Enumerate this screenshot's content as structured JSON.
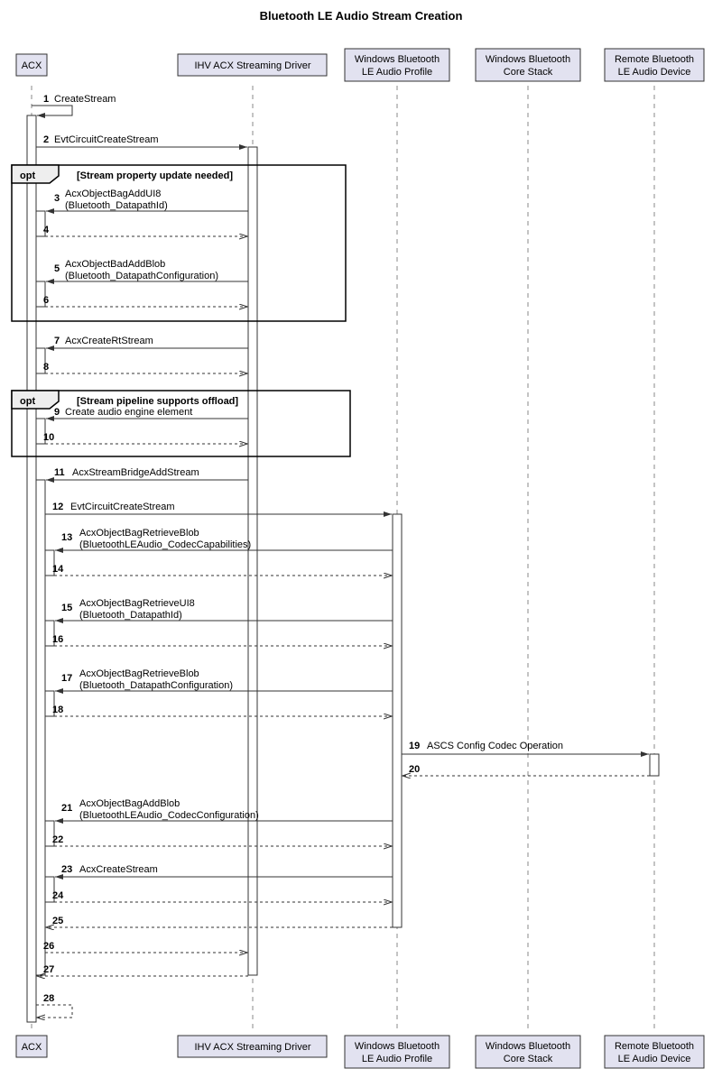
{
  "title": "Bluetooth LE Audio Stream Creation",
  "participants": [
    {
      "name": "ACX",
      "lines": [
        "ACX"
      ]
    },
    {
      "name": "IHV",
      "lines": [
        "IHV ACX Streaming Driver"
      ]
    },
    {
      "name": "WBAP",
      "lines": [
        "Windows Bluetooth",
        "LE Audio Profile"
      ]
    },
    {
      "name": "WBCS",
      "lines": [
        "Windows Bluetooth",
        "Core Stack"
      ]
    },
    {
      "name": "RBLD",
      "lines": [
        "Remote Bluetooth",
        "LE Audio Device"
      ]
    }
  ],
  "opt1_label": "opt",
  "opt1_cond": "[Stream property update needed]",
  "opt2_label": "opt",
  "opt2_cond": "[Stream pipeline supports offload]",
  "messages": {
    "m1": "CreateStream",
    "m2": "EvtCircuitCreateStream",
    "m3a": "AcxObjectBagAddUI8",
    "m3b": "(Bluetooth_DatapathId)",
    "m5a": "AcxObjectBadAddBlob",
    "m5b": "(Bluetooth_DatapathConfiguration)",
    "m7": "AcxCreateRtStream",
    "m9": "Create audio engine element",
    "m11": "AcxStreamBridgeAddStream",
    "m12": "EvtCircuitCreateStream",
    "m13a": "AcxObjectBagRetrieveBlob",
    "m13b": "(BluetoothLEAudio_CodecCapabilities)",
    "m15a": "AcxObjectBagRetrieveUI8",
    "m15b": "(Bluetooth_DatapathId)",
    "m17a": "AcxObjectBagRetrieveBlob",
    "m17b": "(Bluetooth_DatapathConfiguration)",
    "m19": "ASCS Config Codec Operation",
    "m21a": "AcxObjectBagAddBlob",
    "m21b": "(BluetoothLEAudio_CodecConfiguration)",
    "m23": "AcxCreateStream"
  },
  "chart_data": {
    "type": "sequence-diagram",
    "title": "Bluetooth LE Audio Stream Creation",
    "participants": [
      "ACX",
      "IHV ACX Streaming Driver",
      "Windows Bluetooth LE Audio Profile",
      "Windows Bluetooth Core Stack",
      "Remote Bluetooth LE Audio Device"
    ],
    "messages": [
      {
        "n": 1,
        "from": "ACX",
        "to": "ACX",
        "label": "CreateStream",
        "type": "solid"
      },
      {
        "n": 2,
        "from": "ACX",
        "to": "IHV ACX Streaming Driver",
        "label": "EvtCircuitCreateStream",
        "type": "solid"
      },
      {
        "fragment": "opt",
        "condition": "Stream property update needed",
        "contains": [
          {
            "n": 3,
            "from": "IHV ACX Streaming Driver",
            "to": "ACX",
            "label": "AcxObjectBagAddUI8 (Bluetooth_DatapathId)",
            "type": "solid"
          },
          {
            "n": 4,
            "from": "ACX",
            "to": "IHV ACX Streaming Driver",
            "label": "",
            "type": "dashed"
          },
          {
            "n": 5,
            "from": "IHV ACX Streaming Driver",
            "to": "ACX",
            "label": "AcxObjectBadAddBlob (Bluetooth_DatapathConfiguration)",
            "type": "solid"
          },
          {
            "n": 6,
            "from": "ACX",
            "to": "IHV ACX Streaming Driver",
            "label": "",
            "type": "dashed"
          }
        ]
      },
      {
        "n": 7,
        "from": "IHV ACX Streaming Driver",
        "to": "ACX",
        "label": "AcxCreateRtStream",
        "type": "solid"
      },
      {
        "n": 8,
        "from": "ACX",
        "to": "IHV ACX Streaming Driver",
        "label": "",
        "type": "dashed"
      },
      {
        "fragment": "opt",
        "condition": "Stream pipeline supports offload",
        "contains": [
          {
            "n": 9,
            "from": "IHV ACX Streaming Driver",
            "to": "ACX",
            "label": "Create audio engine element",
            "type": "solid"
          },
          {
            "n": 10,
            "from": "ACX",
            "to": "IHV ACX Streaming Driver",
            "label": "",
            "type": "dashed"
          }
        ]
      },
      {
        "n": 11,
        "from": "IHV ACX Streaming Driver",
        "to": "ACX",
        "label": "AcxStreamBridgeAddStream",
        "type": "solid"
      },
      {
        "n": 12,
        "from": "ACX",
        "to": "Windows Bluetooth LE Audio Profile",
        "label": "EvtCircuitCreateStream",
        "type": "solid"
      },
      {
        "n": 13,
        "from": "Windows Bluetooth LE Audio Profile",
        "to": "ACX",
        "label": "AcxObjectBagRetrieveBlob (BluetoothLEAudio_CodecCapabilities)",
        "type": "solid"
      },
      {
        "n": 14,
        "from": "ACX",
        "to": "Windows Bluetooth LE Audio Profile",
        "label": "",
        "type": "dashed"
      },
      {
        "n": 15,
        "from": "Windows Bluetooth LE Audio Profile",
        "to": "ACX",
        "label": "AcxObjectBagRetrieveUI8 (Bluetooth_DatapathId)",
        "type": "solid"
      },
      {
        "n": 16,
        "from": "ACX",
        "to": "Windows Bluetooth LE Audio Profile",
        "label": "",
        "type": "dashed"
      },
      {
        "n": 17,
        "from": "Windows Bluetooth LE Audio Profile",
        "to": "ACX",
        "label": "AcxObjectBagRetrieveBlob (Bluetooth_DatapathConfiguration)",
        "type": "solid"
      },
      {
        "n": 18,
        "from": "ACX",
        "to": "Windows Bluetooth LE Audio Profile",
        "label": "",
        "type": "dashed"
      },
      {
        "n": 19,
        "from": "Windows Bluetooth LE Audio Profile",
        "to": "Remote Bluetooth LE Audio Device",
        "label": "ASCS Config Codec Operation",
        "type": "solid"
      },
      {
        "n": 20,
        "from": "Remote Bluetooth LE Audio Device",
        "to": "Windows Bluetooth LE Audio Profile",
        "label": "",
        "type": "dashed"
      },
      {
        "n": 21,
        "from": "Windows Bluetooth LE Audio Profile",
        "to": "ACX",
        "label": "AcxObjectBagAddBlob (BluetoothLEAudio_CodecConfiguration)",
        "type": "solid"
      },
      {
        "n": 22,
        "from": "ACX",
        "to": "Windows Bluetooth LE Audio Profile",
        "label": "",
        "type": "dashed"
      },
      {
        "n": 23,
        "from": "Windows Bluetooth LE Audio Profile",
        "to": "ACX",
        "label": "AcxCreateStream",
        "type": "solid"
      },
      {
        "n": 24,
        "from": "ACX",
        "to": "Windows Bluetooth LE Audio Profile",
        "label": "",
        "type": "dashed"
      },
      {
        "n": 25,
        "from": "Windows Bluetooth LE Audio Profile",
        "to": "ACX",
        "label": "",
        "type": "dashed"
      },
      {
        "n": 26,
        "from": "ACX",
        "to": "IHV ACX Streaming Driver",
        "label": "",
        "type": "dashed"
      },
      {
        "n": 27,
        "from": "IHV ACX Streaming Driver",
        "to": "ACX",
        "label": "",
        "type": "dashed"
      },
      {
        "n": 28,
        "from": "ACX",
        "to": "ACX",
        "label": "",
        "type": "dashed"
      }
    ]
  }
}
